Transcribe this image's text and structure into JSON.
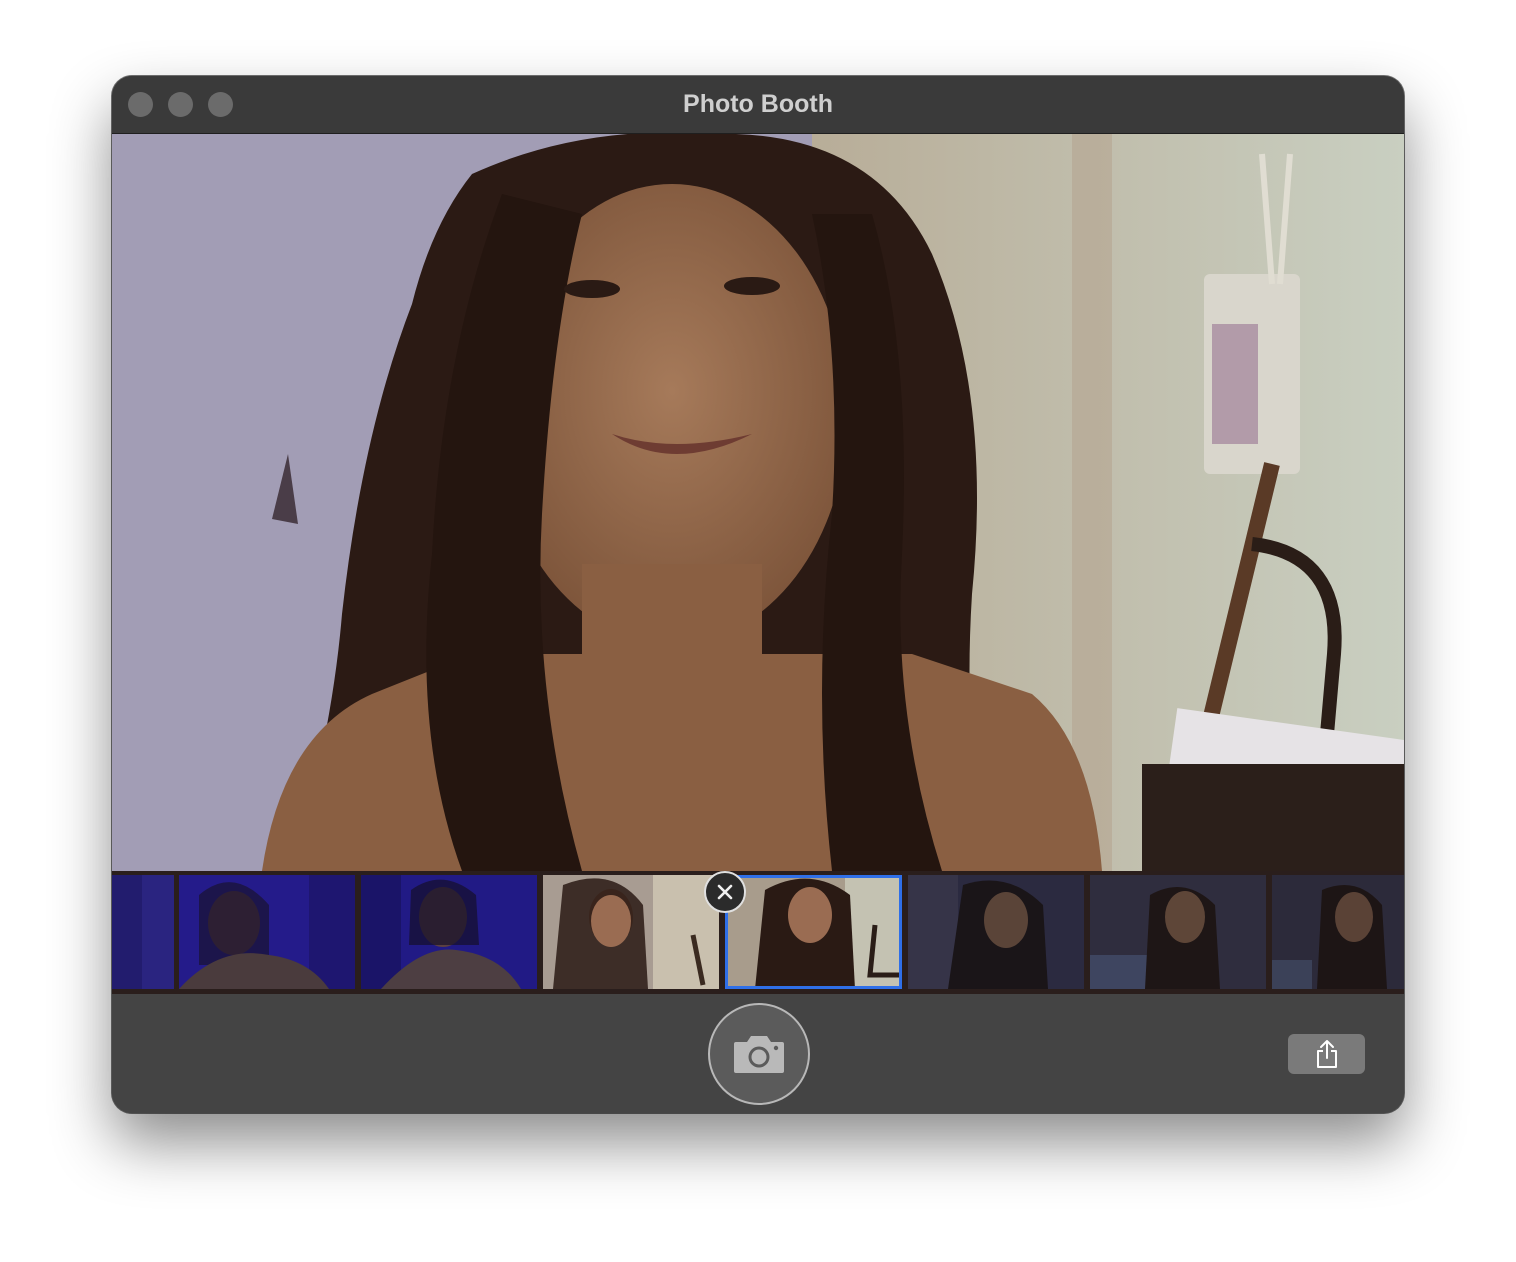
{
  "window": {
    "title": "Photo Booth"
  },
  "colors": {
    "window_bg": "#444444",
    "titlebar_bg": "#3a3a3a",
    "selection_accent": "#2f6fe8",
    "traffic_light": "#6b6b6b"
  },
  "icons": {
    "shutter": "camera-icon",
    "share": "share-icon",
    "remove": "close-icon"
  },
  "thumbnails": {
    "count": 8,
    "selected_index": 4
  }
}
